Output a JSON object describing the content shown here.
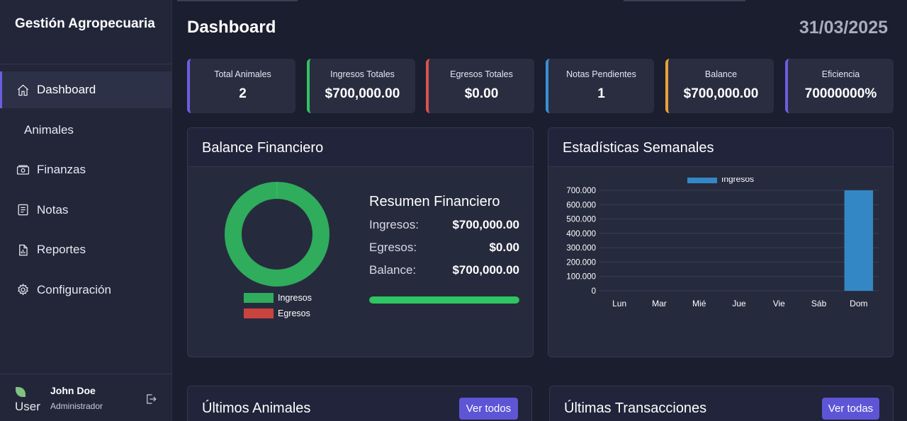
{
  "brand": {
    "title": "Gestión Agropecuaria"
  },
  "nav": [
    {
      "label": "Dashboard",
      "icon": "home-icon",
      "active": true
    },
    {
      "label": "Animales",
      "icon": "",
      "active": false
    },
    {
      "label": "Finanzas",
      "icon": "money-icon",
      "active": false
    },
    {
      "label": "Notas",
      "icon": "notes-icon",
      "active": false
    },
    {
      "label": "Reportes",
      "icon": "report-icon",
      "active": false
    },
    {
      "label": "Configuración",
      "icon": "gear-icon",
      "active": false
    }
  ],
  "user": {
    "avatar_alt": "User",
    "name": "John Doe",
    "role": "Administrador"
  },
  "header": {
    "title": "Dashboard",
    "date": "31/03/2025"
  },
  "stats": [
    {
      "label": "Total Animales",
      "value": "2",
      "color": "#6b5ee0"
    },
    {
      "label": "Ingresos Totales",
      "value": "$700,000.00",
      "color": "#2fc562"
    },
    {
      "label": "Egresos Totales",
      "value": "$0.00",
      "color": "#d9534f"
    },
    {
      "label": "Notas Pendientes",
      "value": "1",
      "color": "#3a8fd9"
    },
    {
      "label": "Balance",
      "value": "$700,000.00",
      "color": "#e8a23a"
    },
    {
      "label": "Eficiencia",
      "value": "70000000%",
      "color": "#6b5ee0"
    }
  ],
  "balance_panel": {
    "title": "Balance Financiero",
    "legend": [
      {
        "label": "Ingresos",
        "color": "#2fac5c"
      },
      {
        "label": "Egresos",
        "color": "#c9443f"
      }
    ],
    "summary_title": "Resumen Financiero",
    "rows": [
      {
        "key": "Ingresos:",
        "value": "$700,000.00"
      },
      {
        "key": "Egresos:",
        "value": "$0.00"
      },
      {
        "key": "Balance:",
        "value": "$700,000.00"
      }
    ],
    "progress": 1.0
  },
  "weekly_panel": {
    "title": "Estadísticas Semanales"
  },
  "animals_panel": {
    "title": "Últimos Animales",
    "button": "Ver todos"
  },
  "transactions_panel": {
    "title": "Últimas Transacciones",
    "button": "Ver todas"
  },
  "chart_data": [
    {
      "type": "pie",
      "categories": [
        "Ingresos",
        "Egresos"
      ],
      "values": [
        700000,
        0
      ],
      "colors": [
        "#2fac5c",
        "#c9443f"
      ],
      "donut": true
    },
    {
      "type": "bar",
      "categories": [
        "Lun",
        "Mar",
        "Mié",
        "Jue",
        "Vie",
        "Sáb",
        "Dom"
      ],
      "series": [
        {
          "name": "Ingresos",
          "values": [
            0,
            0,
            0,
            0,
            0,
            0,
            700000
          ],
          "color": "#3487c5"
        }
      ],
      "yticks": [
        "0",
        "100.000",
        "200.000",
        "300.000",
        "400.000",
        "500.000",
        "600.000",
        "700.000"
      ],
      "ylim": [
        0,
        700000
      ],
      "grid": true,
      "legend_position": "top"
    }
  ]
}
